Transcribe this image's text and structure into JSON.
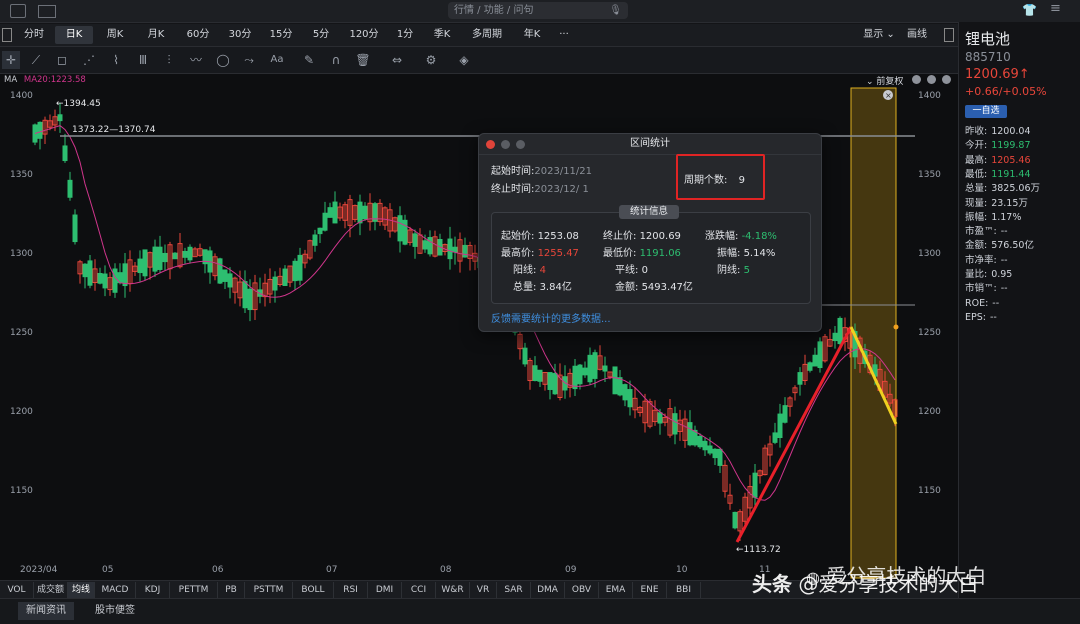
{
  "search": {
    "placeholder": "行情 / 功能 / 问句"
  },
  "periods": [
    "分时",
    "日K",
    "周K",
    "月K",
    "60分",
    "30分",
    "15分",
    "5分",
    "120分",
    "1分",
    "季K",
    "多周期",
    "年K",
    "···"
  ],
  "period_active": 1,
  "display": {
    "show": "显示",
    "draw": "画线"
  },
  "indicator": {
    "name": "MA",
    "ma20": "MA20:1223.58",
    "adjust": "前复权"
  },
  "price_axis": {
    "left": [
      "1400",
      "1350",
      "1300",
      "1250",
      "1200",
      "1150"
    ],
    "right": [
      "1400",
      "1350",
      "1300",
      "1250",
      "1200",
      "1150"
    ]
  },
  "date_axis": [
    "2023/04",
    "05",
    "06",
    "07",
    "08",
    "09",
    "10",
    "11"
  ],
  "annotations": {
    "high": "←1394.45",
    "hline": "1373.22—1370.74",
    "low": "←1113.72"
  },
  "dialog": {
    "title": "区间统计",
    "start_label": "起始时间:",
    "start_value": "2023/11/21",
    "end_label": "终止时间:",
    "end_value": "2023/12/  1",
    "period_count_label": "周期个数:",
    "period_count": "9",
    "info_title": "统计信息",
    "stats": {
      "start_price_label": "起始价:",
      "start_price": "1253.08",
      "end_price_label": "终止价:",
      "end_price": "1200.69",
      "change_label": "涨跌幅:",
      "change": "-4.18%",
      "high_label": "最高价:",
      "high": "1255.47",
      "low_label": "最低价:",
      "low": "1191.06",
      "amp_label": "振幅:",
      "amp": "5.14%",
      "yang_label": "阳线:",
      "yang": "4",
      "flat_label": "平线:",
      "flat": "0",
      "yin_label": "阴线:",
      "yin": "5",
      "vol_label": "总量:",
      "vol": "3.84亿",
      "amt_label": "金额:",
      "amt": "5493.47亿"
    },
    "feedback": "反馈需要统计的更多数据..."
  },
  "sidebar": {
    "name": "锂电池",
    "code": "885710",
    "price": "1200.69↑",
    "change": "+0.66/+0.05%",
    "watch": "一自选",
    "rows": [
      {
        "k": "昨收:",
        "v": "1200.04",
        "c": "#cfd3da"
      },
      {
        "k": "今开:",
        "v": "1199.87",
        "c": "#2dbe70"
      },
      {
        "k": "最高:",
        "v": "1205.46",
        "c": "#e8463a"
      },
      {
        "k": "最低:",
        "v": "1191.44",
        "c": "#2dbe70"
      },
      {
        "k": "总量:",
        "v": "3825.06万",
        "c": "#cfd3da"
      },
      {
        "k": "现量:",
        "v": "23.15万",
        "c": "#cfd3da"
      },
      {
        "k": "振幅:",
        "v": "1.17%",
        "c": "#cfd3da"
      },
      {
        "k": "市盈™:",
        "v": "--",
        "c": "#cfd3da"
      },
      {
        "k": "金额:",
        "v": "576.50亿",
        "c": "#cfd3da"
      },
      {
        "k": "市净率:",
        "v": "--",
        "c": "#cfd3da"
      },
      {
        "k": "量比:",
        "v": "0.95",
        "c": "#cfd3da"
      },
      {
        "k": "市销™:",
        "v": "--",
        "c": "#cfd3da"
      },
      {
        "k": "ROE:",
        "v": "--",
        "c": "#cfd3da"
      },
      {
        "k": "EPS:",
        "v": "--",
        "c": "#cfd3da"
      }
    ]
  },
  "bottom_tabs": [
    "VOL",
    "成交额",
    "均线",
    "MACD",
    "KDJ",
    "PETTM",
    "PB",
    "PSTTM",
    "BOLL",
    "RSI",
    "DMI",
    "CCI",
    "W&R",
    "VR",
    "SAR",
    "DMA",
    "OBV",
    "EMA",
    "ENE",
    "BBI"
  ],
  "bottom_active": 2,
  "news_tabs": [
    "新闻资讯",
    "股市便签"
  ],
  "watermark": {
    "source": "头条",
    "account": "@爱分享技术的大白",
    "wechat": "爱分享技术的大白"
  },
  "colors": {
    "up": "#e8463a",
    "down": "#2dbe70",
    "ma": "#d0358c",
    "highlight": "#f0c419",
    "trend": "#e8202a"
  }
}
